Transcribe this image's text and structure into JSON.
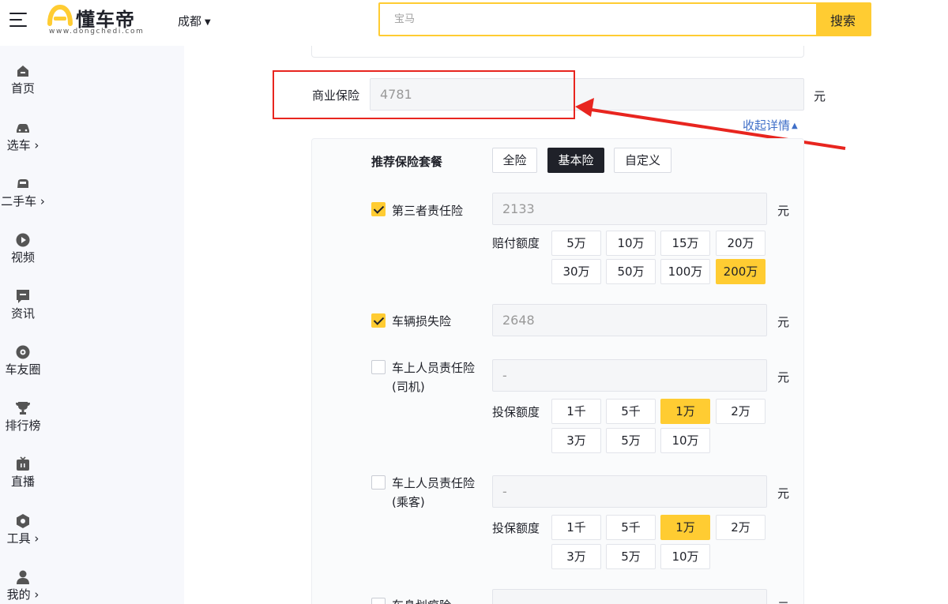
{
  "header": {
    "logo_text": "懂车帝",
    "logo_url": "www.dongchedi.com",
    "city": "成都",
    "search_placeholder": "宝马",
    "search_button": "搜索"
  },
  "sidebar": {
    "items": [
      {
        "label": "首页",
        "icon": "home-icon"
      },
      {
        "label": "选车 ›",
        "icon": "car-icon"
      },
      {
        "label": "二手车 ›",
        "icon": "used-car-icon"
      },
      {
        "label": "视频",
        "icon": "play-icon"
      },
      {
        "label": "资讯",
        "icon": "news-icon"
      },
      {
        "label": "车友圈",
        "icon": "circle-icon"
      },
      {
        "label": "排行榜",
        "icon": "trophy-icon"
      },
      {
        "label": "直播",
        "icon": "live-icon"
      },
      {
        "label": "工具 ›",
        "icon": "tool-icon"
      },
      {
        "label": "我的 ›",
        "icon": "user-icon"
      }
    ]
  },
  "commercial": {
    "label": "商业保险",
    "value": "4781",
    "unit": "元",
    "collapse": "收起详情"
  },
  "package": {
    "title": "推荐保险套餐",
    "options": [
      "全险",
      "基本险",
      "自定义"
    ],
    "active": "基本险"
  },
  "items": [
    {
      "name": "第三者责任险",
      "checked": true,
      "value": "2133",
      "unit": "元",
      "option_label": "赔付额度",
      "options": [
        "5万",
        "10万",
        "15万",
        "20万",
        "30万",
        "50万",
        "100万",
        "200万"
      ],
      "selected": "200万"
    },
    {
      "name": "车辆损失险",
      "checked": true,
      "value": "2648",
      "unit": "元"
    },
    {
      "name_line1": "车上人员责任险",
      "name_line2": "(司机)",
      "checked": false,
      "value": "-",
      "unit": "元",
      "option_label": "投保额度",
      "options": [
        "1千",
        "5千",
        "1万",
        "2万",
        "3万",
        "5万",
        "10万"
      ],
      "selected": "1万"
    },
    {
      "name_line1": "车上人员责任险",
      "name_line2": "(乘客)",
      "checked": false,
      "value": "-",
      "unit": "元",
      "option_label": "投保额度",
      "options": [
        "1千",
        "5千",
        "1万",
        "2万",
        "3万",
        "5万",
        "10万"
      ],
      "selected": "1万"
    },
    {
      "name": "车身划痕险",
      "checked": false,
      "unit": "元"
    }
  ],
  "colors": {
    "accent": "#ffcc32",
    "annotation_red": "#e8251f",
    "link": "#3f6fc8"
  }
}
